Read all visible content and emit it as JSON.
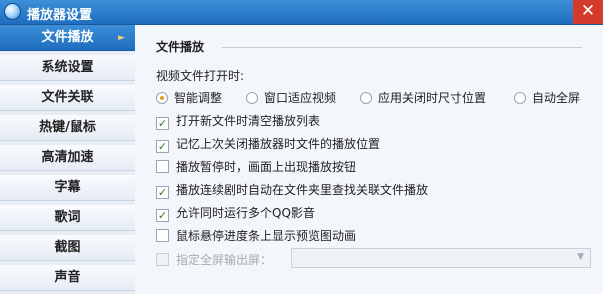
{
  "window": {
    "title": "播放器设置",
    "close_icon": "✕"
  },
  "sidebar": {
    "items": [
      {
        "label": "文件播放",
        "active": true
      },
      {
        "label": "系统设置"
      },
      {
        "label": "文件关联"
      },
      {
        "label": "热键/鼠标"
      },
      {
        "label": "高清加速"
      },
      {
        "label": "字幕"
      },
      {
        "label": "歌词"
      },
      {
        "label": "截图"
      },
      {
        "label": "声音"
      }
    ],
    "active_arrow": "►"
  },
  "content": {
    "section_title": "文件播放",
    "open_label": "视频文件打开时:",
    "radios": [
      {
        "label": "智能调整",
        "checked": true
      },
      {
        "label": "窗口适应视频",
        "checked": false
      },
      {
        "label": "应用关闭时尺寸位置",
        "checked": false
      },
      {
        "label": "自动全屏",
        "checked": false
      }
    ],
    "checkboxes": [
      {
        "label": "打开新文件时清空播放列表",
        "checked": true
      },
      {
        "label": "记忆上次关闭播放器时文件的播放位置",
        "checked": true
      },
      {
        "label": "播放暂停时，画面上出现播放按钮",
        "checked": false
      },
      {
        "label": "播放连续剧时自动在文件夹里查找关联文件播放",
        "checked": true
      },
      {
        "label": "允许同时运行多个QQ影音",
        "checked": true
      },
      {
        "label": "鼠标悬停进度条上显示预览图动画",
        "checked": false
      }
    ],
    "fullscreen_output": {
      "label": "指定全屏输出屏：",
      "checked": false,
      "disabled": true,
      "value": ""
    },
    "check_mark": "✓",
    "dropdown_arrow": "▼"
  },
  "colors": {
    "titlebar": "#2a7fd0",
    "active_nav": "#2a7fd0",
    "close": "#d43b2c",
    "radio_selected": "#e2a31a"
  }
}
